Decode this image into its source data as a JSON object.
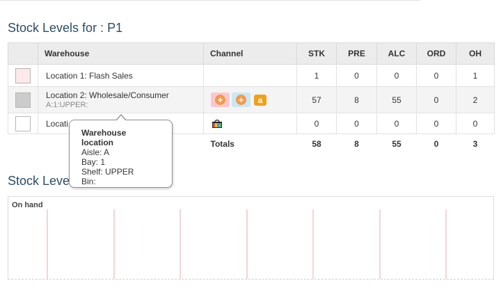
{
  "page": {
    "title_prefix": "Stock Levels for : ",
    "product": "P1",
    "chart_title_visible": "Stock Leve"
  },
  "table": {
    "headers": {
      "warehouse": "Warehouse",
      "channel": "Channel",
      "stk": "STK",
      "pre": "PRE",
      "alc": "ALC",
      "ord": "ORD",
      "oh": "OH"
    },
    "rows": [
      {
        "swatch_color": "#fde8ea",
        "warehouse": "Location 1: Flash Sales",
        "location_code": "",
        "channels": [],
        "stk": "1",
        "pre": "0",
        "alc": "0",
        "ord": "0",
        "oh": "1"
      },
      {
        "swatch_color": "#cccccc",
        "warehouse": "Location 2: Wholesale/Consumer",
        "location_code": "A:1:UPPER:",
        "channels": [
          "pink-plus-icon",
          "blue-plus-icon",
          "amazon-icon"
        ],
        "stk": "57",
        "pre": "8",
        "alc": "55",
        "ord": "0",
        "oh": "2"
      },
      {
        "swatch_color": "#ffffff",
        "warehouse": "Locati",
        "location_code": "",
        "channels": [
          "shopping-bag-icon"
        ],
        "stk": "0",
        "pre": "0",
        "alc": "0",
        "ord": "0",
        "oh": "0"
      }
    ],
    "totals": {
      "label": "Totals",
      "stk": "58",
      "pre": "8",
      "alc": "55",
      "ord": "0",
      "oh": "3"
    }
  },
  "tooltip": {
    "title": "Warehouse location",
    "aisle": "Aisle: A",
    "bay": "Bay: 1",
    "shelf": "Shelf: UPPER",
    "bin": "Bin:"
  },
  "chart": {
    "label": "On hand",
    "line_color": "#e8a8a8"
  }
}
